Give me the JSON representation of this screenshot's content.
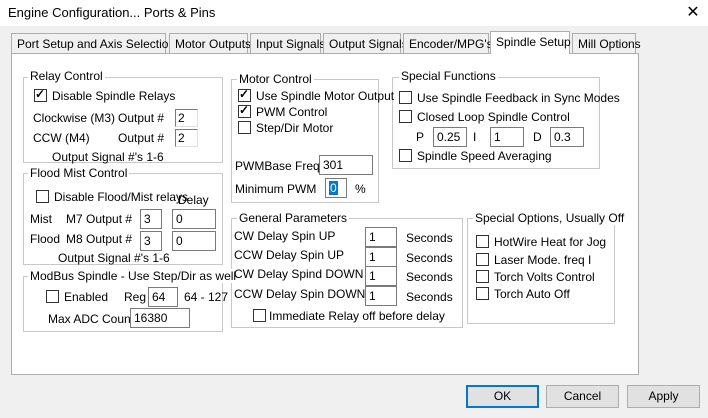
{
  "window": {
    "title": "Engine Configuration... Ports & Pins",
    "close_glyph": "✕"
  },
  "tabs": [
    {
      "label": "Port Setup and Axis Selection"
    },
    {
      "label": "Motor Outputs"
    },
    {
      "label": "Input Signals"
    },
    {
      "label": "Output Signals"
    },
    {
      "label": "Encoder/MPG's"
    },
    {
      "label": "Spindle Setup",
      "active": true
    },
    {
      "label": "Mill Options"
    }
  ],
  "relay_control": {
    "title": "Relay Control",
    "disable_label": "Disable Spindle Relays",
    "disable_checked": true,
    "cw_label": "Clockwise (M3)",
    "ccw_label": "CCW (M4)",
    "output_label": "Output #",
    "cw_output": "2",
    "ccw_output": "2",
    "footer": "Output Signal #'s 1-6"
  },
  "flood_mist": {
    "title": "Flood Mist Control",
    "disable_label": "Disable Flood/Mist relays",
    "disable_checked": false,
    "delay_label": "Delay",
    "mist_label": "Mist",
    "mist_output_label": "M7 Output #",
    "mist_output": "3",
    "mist_delay": "0",
    "flood_label": "Flood",
    "flood_output_label": "M8 Output #",
    "flood_output": "3",
    "flood_delay": "0",
    "footer": "Output Signal #'s 1-6"
  },
  "modbus": {
    "title": "ModBus Spindle - Use Step/Dir as well",
    "enabled_label": "Enabled",
    "enabled_checked": false,
    "reg_label": "Reg",
    "reg_value": "64",
    "reg_range": "64 - 127",
    "max_adc_label": "Max ADC Count",
    "max_adc_value": "16380"
  },
  "motor_control": {
    "title": "Motor Control",
    "use_spindle_label": "Use Spindle Motor Output",
    "use_spindle_checked": true,
    "pwm_label": "PWM Control",
    "pwm_checked": true,
    "stepdir_label": "Step/Dir Motor",
    "stepdir_checked": false,
    "pwm_base_label": "PWMBase Freq.",
    "pwm_base_value": "301",
    "min_pwm_label": "Minimum PWM",
    "min_pwm_value": "0",
    "min_pwm_unit": "%"
  },
  "general": {
    "title": "General Parameters",
    "rows": [
      {
        "label": "CW Delay Spin UP",
        "value": "1",
        "unit": "Seconds"
      },
      {
        "label": "CCW Delay Spin UP",
        "value": "1",
        "unit": "Seconds"
      },
      {
        "label": "CW Delay Spind DOWN",
        "value": "1",
        "unit": "Seconds"
      },
      {
        "label": "CCW Delay Spin DOWN",
        "value": "1",
        "unit": "Seconds"
      }
    ],
    "immediate_label": "Immediate Relay off before delay",
    "immediate_checked": false
  },
  "special_functions": {
    "title": "Special Functions",
    "feedback_label": "Use Spindle Feedback in Sync Modes",
    "feedback_checked": false,
    "closed_loop_label": "Closed Loop Spindle Control",
    "closed_loop_checked": false,
    "p_label": "P",
    "p_value": "0.25",
    "i_label": "I",
    "i_value": "1",
    "d_label": "D",
    "d_value": "0.3",
    "averaging_label": "Spindle Speed Averaging",
    "averaging_checked": false
  },
  "special_options": {
    "title": "Special Options, Usually Off",
    "items": [
      {
        "label": "HotWire Heat for Jog",
        "checked": false
      },
      {
        "label": "Laser Mode. freq I",
        "checked": false
      },
      {
        "label": "Torch Volts Control",
        "checked": false
      },
      {
        "label": "Torch Auto Off",
        "checked": false
      }
    ]
  },
  "buttons": {
    "ok": "OK",
    "cancel": "Cancel",
    "apply": "Apply"
  }
}
